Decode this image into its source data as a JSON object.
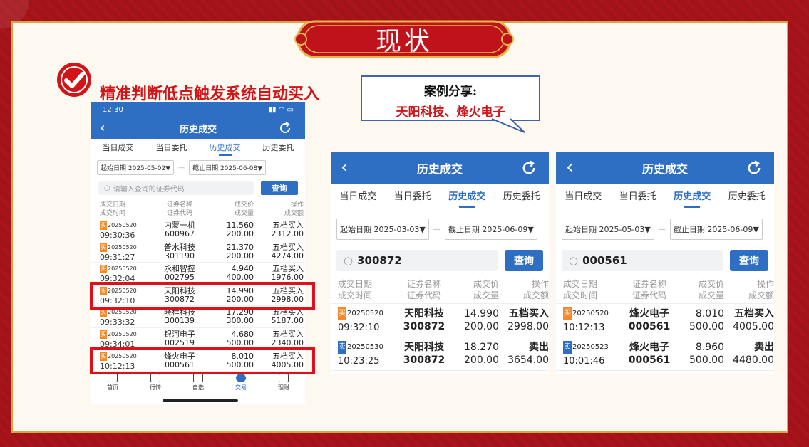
{
  "banner": {
    "title": "现状"
  },
  "headline": "精准判断低点触发系统自动买入",
  "callout": {
    "line1": "案例分享:",
    "line2": "天阳科技、烽火电子"
  },
  "phone": {
    "status_time": "12:30",
    "nav_title": "历史成交",
    "tabs": [
      "当日成交",
      "当日委托",
      "历史成交",
      "历史委托"
    ],
    "active_tab": 2,
    "start_date": "起始日期 2025-05-02▼",
    "end_date": "截止日期 2025-06-08▼",
    "search_placeholder": "请输入查询的证券代码",
    "search_button": "查询",
    "headers": {
      "c1a": "成交日期",
      "c1b": "成交时间",
      "c2a": "证券名称",
      "c2b": "证券代码",
      "c3a": "成交价",
      "c3b": "成交量",
      "c4a": "操作",
      "c4b": "成交额"
    },
    "rows": [
      {
        "badge": "买",
        "date": "20250520",
        "time": "09:30:36",
        "name": "内蒙一机",
        "code": "600967",
        "price": "11.560",
        "qty": "200.00",
        "op": "五档买入",
        "amount": "2312.00"
      },
      {
        "badge": "买",
        "date": "20250520",
        "time": "09:31:27",
        "name": "普水科技",
        "code": "301190",
        "price": "21.370",
        "qty": "200.00",
        "op": "五档买入",
        "amount": "4274.00"
      },
      {
        "badge": "买",
        "date": "20250520",
        "time": "09:32:04",
        "name": "永和智控",
        "code": "002795",
        "price": "4.940",
        "qty": "400.00",
        "op": "五档买入",
        "amount": "1976.00"
      },
      {
        "badge": "买",
        "date": "20250520",
        "time": "09:32:10",
        "name": "天阳科技",
        "code": "300872",
        "price": "14.990",
        "qty": "200.00",
        "op": "五档买入",
        "amount": "2998.00"
      },
      {
        "badge": "买",
        "date": "20250520",
        "time": "09:33:32",
        "name": "晓程科技",
        "code": "300139",
        "price": "17.290",
        "qty": "300.00",
        "op": "五档买入",
        "amount": "5187.00"
      },
      {
        "badge": "买",
        "date": "20250520",
        "time": "09:34:01",
        "name": "银河电子",
        "code": "002519",
        "price": "4.680",
        "qty": "500.00",
        "op": "五档买入",
        "amount": "2340.00"
      },
      {
        "badge": "买",
        "date": "20250520",
        "time": "10:12:13",
        "name": "烽火电子",
        "code": "000561",
        "price": "8.010",
        "qty": "500.00",
        "op": "五档买入",
        "amount": "4005.00"
      }
    ],
    "tabbar": [
      "首页",
      "行情",
      "自选",
      "交易",
      "理财"
    ],
    "tabbar_active": 3
  },
  "panel_a": {
    "nav_title": "历史成交",
    "tabs": [
      "当日成交",
      "当日委托",
      "历史成交",
      "历史委托"
    ],
    "start_date": "起始日期 2025-03-03▼",
    "end_date": "截止日期 2025-06-09▼",
    "search_value": "300872",
    "search_button": "查询",
    "headers": {
      "c1a": "成交日期",
      "c1b": "成交时间",
      "c2a": "证券名称",
      "c2b": "证券代码",
      "c3a": "成交价",
      "c3b": "成交量",
      "c4a": "操作",
      "c4b": "成交额"
    },
    "rows": [
      {
        "badge": "买",
        "date": "20250520",
        "time": "09:32:10",
        "name": "天阳科技",
        "code": "300872",
        "price": "14.990",
        "qty": "200.00",
        "op": "五档买入",
        "amount": "2998.00"
      },
      {
        "badge": "卖",
        "date": "20250530",
        "time": "10:23:25",
        "name": "天阳科技",
        "code": "300872",
        "price": "18.270",
        "qty": "200.00",
        "op": "卖出",
        "amount": "3654.00"
      }
    ]
  },
  "panel_b": {
    "nav_title": "历史成交",
    "tabs": [
      "当日成交",
      "当日委托",
      "历史成交",
      "历史委托"
    ],
    "start_date": "起始日期 2025-05-03▼",
    "end_date": "截止日期 2025-06-09▼",
    "search_value": "000561",
    "search_button": "查询",
    "headers": {
      "c1a": "成交日期",
      "c1b": "成交时间",
      "c2a": "证券名称",
      "c2b": "证券代码",
      "c3a": "成交价",
      "c3b": "成交量",
      "c4a": "操作",
      "c4b": "成交额"
    },
    "rows": [
      {
        "badge": "买",
        "date": "20250520",
        "time": "10:12:13",
        "name": "烽火电子",
        "code": "000561",
        "price": "8.010",
        "qty": "500.00",
        "op": "五档买入",
        "amount": "4005.00"
      },
      {
        "badge": "卖",
        "date": "20250523",
        "time": "10:01:46",
        "name": "烽火电子",
        "code": "000561",
        "price": "8.960",
        "qty": "500.00",
        "op": "卖出",
        "amount": "4480.00"
      }
    ]
  },
  "colors": {
    "brand_blue": "#2e6fc4",
    "highlight_red": "#e0101a",
    "buy_orange": "#f08a2c"
  }
}
